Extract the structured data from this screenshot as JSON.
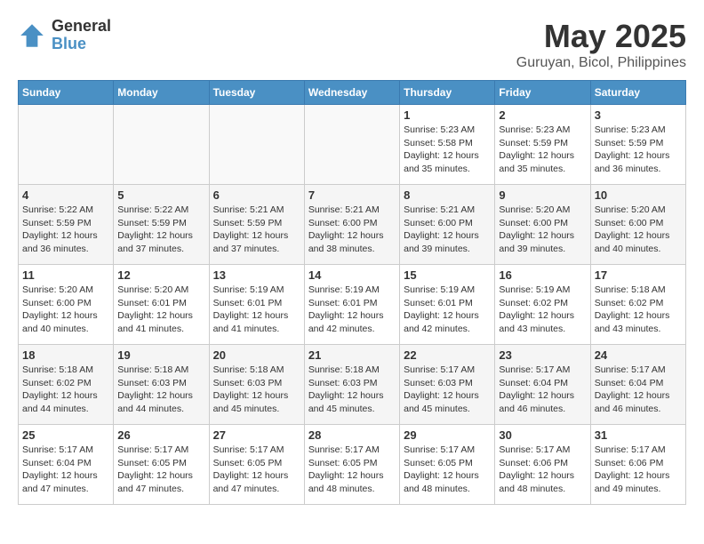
{
  "logo": {
    "general": "General",
    "blue": "Blue"
  },
  "title": "May 2025",
  "subtitle": "Guruyan, Bicol, Philippines",
  "days_of_week": [
    "Sunday",
    "Monday",
    "Tuesday",
    "Wednesday",
    "Thursday",
    "Friday",
    "Saturday"
  ],
  "weeks": [
    [
      {
        "day": "",
        "info": ""
      },
      {
        "day": "",
        "info": ""
      },
      {
        "day": "",
        "info": ""
      },
      {
        "day": "",
        "info": ""
      },
      {
        "day": "1",
        "info": "Sunrise: 5:23 AM\nSunset: 5:58 PM\nDaylight: 12 hours\nand 35 minutes."
      },
      {
        "day": "2",
        "info": "Sunrise: 5:23 AM\nSunset: 5:59 PM\nDaylight: 12 hours\nand 35 minutes."
      },
      {
        "day": "3",
        "info": "Sunrise: 5:23 AM\nSunset: 5:59 PM\nDaylight: 12 hours\nand 36 minutes."
      }
    ],
    [
      {
        "day": "4",
        "info": "Sunrise: 5:22 AM\nSunset: 5:59 PM\nDaylight: 12 hours\nand 36 minutes."
      },
      {
        "day": "5",
        "info": "Sunrise: 5:22 AM\nSunset: 5:59 PM\nDaylight: 12 hours\nand 37 minutes."
      },
      {
        "day": "6",
        "info": "Sunrise: 5:21 AM\nSunset: 5:59 PM\nDaylight: 12 hours\nand 37 minutes."
      },
      {
        "day": "7",
        "info": "Sunrise: 5:21 AM\nSunset: 6:00 PM\nDaylight: 12 hours\nand 38 minutes."
      },
      {
        "day": "8",
        "info": "Sunrise: 5:21 AM\nSunset: 6:00 PM\nDaylight: 12 hours\nand 39 minutes."
      },
      {
        "day": "9",
        "info": "Sunrise: 5:20 AM\nSunset: 6:00 PM\nDaylight: 12 hours\nand 39 minutes."
      },
      {
        "day": "10",
        "info": "Sunrise: 5:20 AM\nSunset: 6:00 PM\nDaylight: 12 hours\nand 40 minutes."
      }
    ],
    [
      {
        "day": "11",
        "info": "Sunrise: 5:20 AM\nSunset: 6:00 PM\nDaylight: 12 hours\nand 40 minutes."
      },
      {
        "day": "12",
        "info": "Sunrise: 5:20 AM\nSunset: 6:01 PM\nDaylight: 12 hours\nand 41 minutes."
      },
      {
        "day": "13",
        "info": "Sunrise: 5:19 AM\nSunset: 6:01 PM\nDaylight: 12 hours\nand 41 minutes."
      },
      {
        "day": "14",
        "info": "Sunrise: 5:19 AM\nSunset: 6:01 PM\nDaylight: 12 hours\nand 42 minutes."
      },
      {
        "day": "15",
        "info": "Sunrise: 5:19 AM\nSunset: 6:01 PM\nDaylight: 12 hours\nand 42 minutes."
      },
      {
        "day": "16",
        "info": "Sunrise: 5:19 AM\nSunset: 6:02 PM\nDaylight: 12 hours\nand 43 minutes."
      },
      {
        "day": "17",
        "info": "Sunrise: 5:18 AM\nSunset: 6:02 PM\nDaylight: 12 hours\nand 43 minutes."
      }
    ],
    [
      {
        "day": "18",
        "info": "Sunrise: 5:18 AM\nSunset: 6:02 PM\nDaylight: 12 hours\nand 44 minutes."
      },
      {
        "day": "19",
        "info": "Sunrise: 5:18 AM\nSunset: 6:03 PM\nDaylight: 12 hours\nand 44 minutes."
      },
      {
        "day": "20",
        "info": "Sunrise: 5:18 AM\nSunset: 6:03 PM\nDaylight: 12 hours\nand 45 minutes."
      },
      {
        "day": "21",
        "info": "Sunrise: 5:18 AM\nSunset: 6:03 PM\nDaylight: 12 hours\nand 45 minutes."
      },
      {
        "day": "22",
        "info": "Sunrise: 5:17 AM\nSunset: 6:03 PM\nDaylight: 12 hours\nand 45 minutes."
      },
      {
        "day": "23",
        "info": "Sunrise: 5:17 AM\nSunset: 6:04 PM\nDaylight: 12 hours\nand 46 minutes."
      },
      {
        "day": "24",
        "info": "Sunrise: 5:17 AM\nSunset: 6:04 PM\nDaylight: 12 hours\nand 46 minutes."
      }
    ],
    [
      {
        "day": "25",
        "info": "Sunrise: 5:17 AM\nSunset: 6:04 PM\nDaylight: 12 hours\nand 47 minutes."
      },
      {
        "day": "26",
        "info": "Sunrise: 5:17 AM\nSunset: 6:05 PM\nDaylight: 12 hours\nand 47 minutes."
      },
      {
        "day": "27",
        "info": "Sunrise: 5:17 AM\nSunset: 6:05 PM\nDaylight: 12 hours\nand 47 minutes."
      },
      {
        "day": "28",
        "info": "Sunrise: 5:17 AM\nSunset: 6:05 PM\nDaylight: 12 hours\nand 48 minutes."
      },
      {
        "day": "29",
        "info": "Sunrise: 5:17 AM\nSunset: 6:05 PM\nDaylight: 12 hours\nand 48 minutes."
      },
      {
        "day": "30",
        "info": "Sunrise: 5:17 AM\nSunset: 6:06 PM\nDaylight: 12 hours\nand 48 minutes."
      },
      {
        "day": "31",
        "info": "Sunrise: 5:17 AM\nSunset: 6:06 PM\nDaylight: 12 hours\nand 49 minutes."
      }
    ]
  ]
}
